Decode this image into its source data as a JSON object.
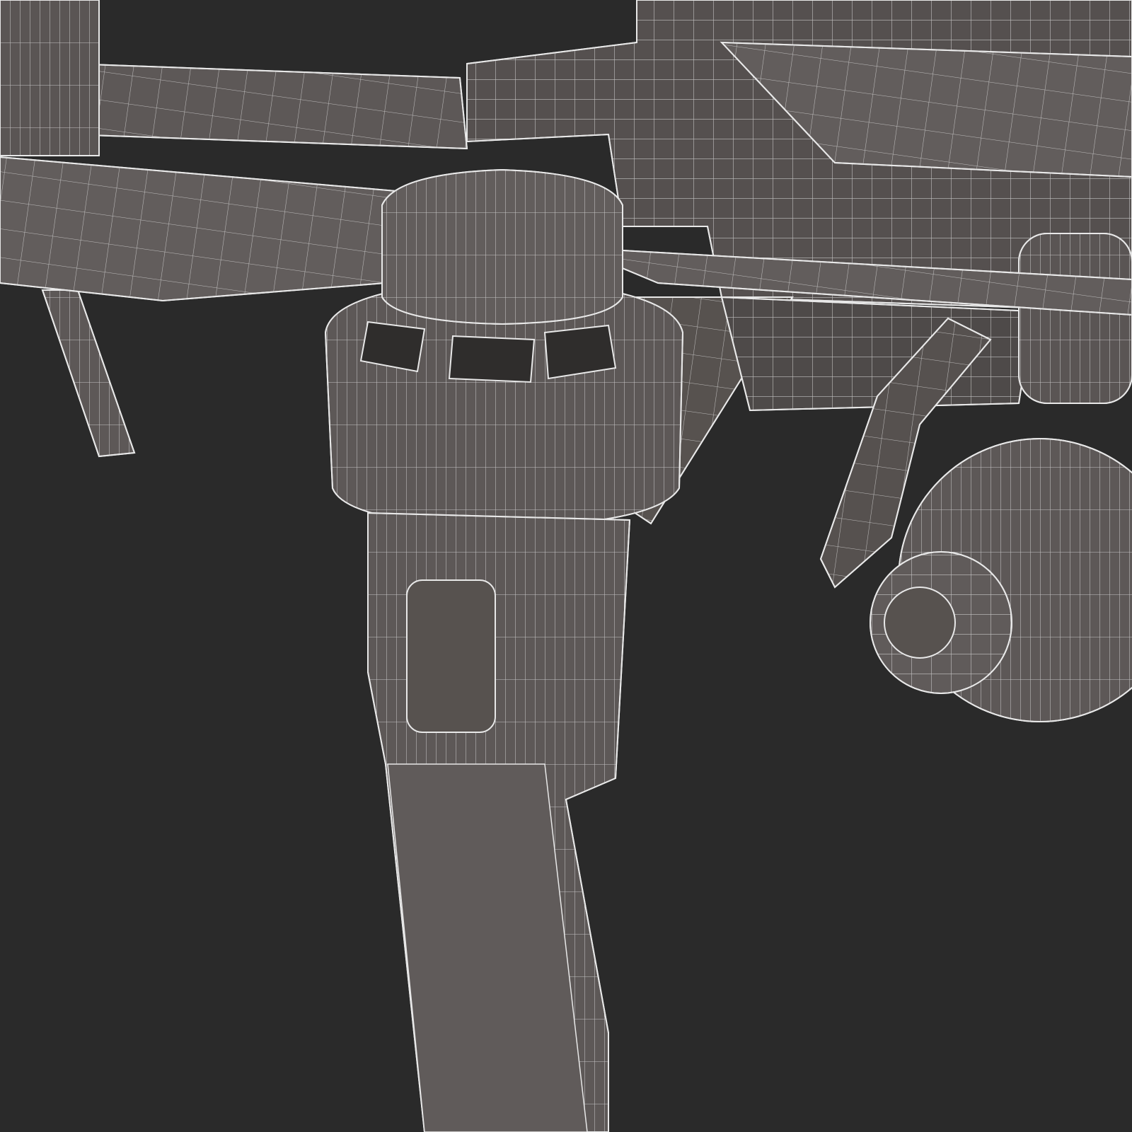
{
  "scene": {
    "subject": "drone-wireframe-render",
    "colors": {
      "background": "#2a2a2a",
      "surface": "#5d5857",
      "surface_dark": "#4a4645",
      "wire": "#e8e8e8"
    }
  }
}
